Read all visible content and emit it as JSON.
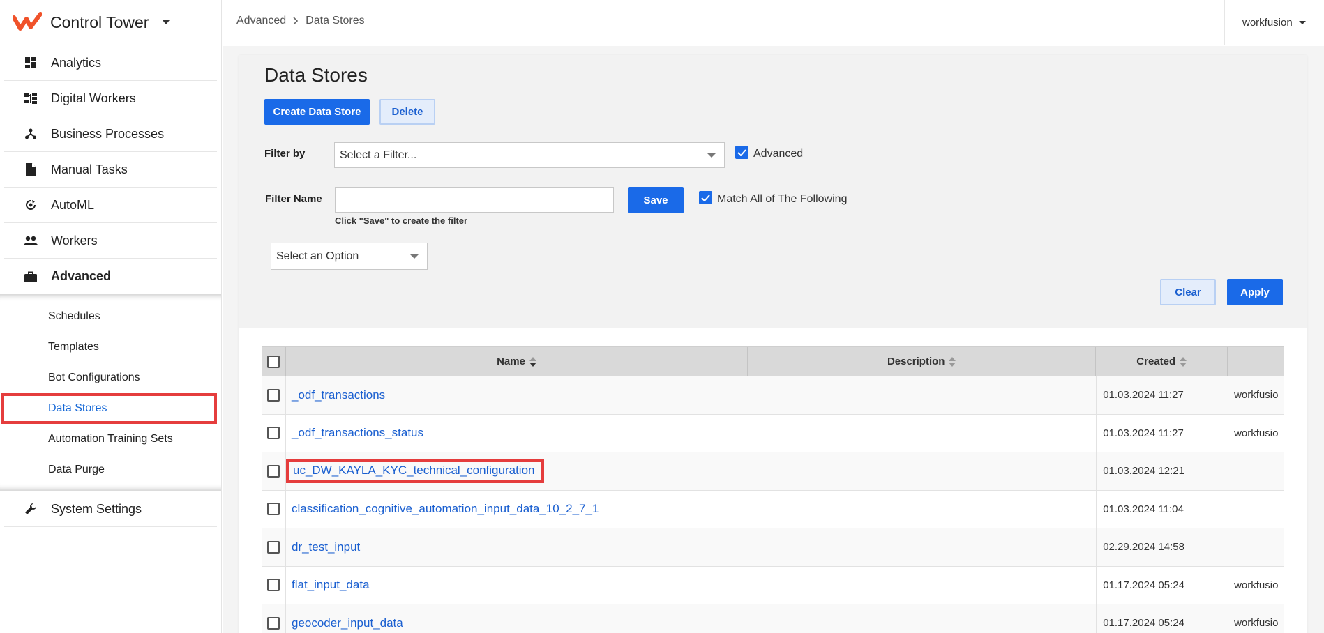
{
  "app": {
    "title": "Control Tower"
  },
  "sidebar": {
    "items": [
      {
        "label": "Analytics",
        "icon": "dashboard-icon"
      },
      {
        "label": "Digital Workers",
        "icon": "sitemap-icon"
      },
      {
        "label": "Business Processes",
        "icon": "process-icon"
      },
      {
        "label": "Manual Tasks",
        "icon": "document-icon"
      },
      {
        "label": "AutoML",
        "icon": "automl-icon"
      },
      {
        "label": "Workers",
        "icon": "people-icon"
      },
      {
        "label": "Advanced",
        "icon": "briefcase-icon"
      }
    ],
    "advanced_sub": [
      {
        "label": "Schedules"
      },
      {
        "label": "Templates"
      },
      {
        "label": "Bot Configurations"
      },
      {
        "label": "Data Stores"
      },
      {
        "label": "Automation Training Sets"
      },
      {
        "label": "Data Purge"
      }
    ],
    "bottom_item": {
      "label": "System Settings",
      "icon": "wrench-icon"
    },
    "active_item": "Advanced",
    "selected_sub": "Data Stores"
  },
  "header": {
    "breadcrumb": [
      "Advanced",
      "Data Stores"
    ],
    "user": "workfusion"
  },
  "page": {
    "title": "Data Stores",
    "create_label": "Create Data Store",
    "delete_label": "Delete",
    "filter_by_label": "Filter by",
    "filter_select_placeholder": "Select a Filter...",
    "advanced_label": "Advanced",
    "advanced_checked": true,
    "filter_name_label": "Filter Name",
    "filter_name_value": "",
    "save_label": "Save",
    "save_hint": "Click \"Save\" to create the filter",
    "match_all_label": "Match All of The Following",
    "match_all_checked": true,
    "option_select_placeholder": "Select an Option",
    "clear_label": "Clear",
    "apply_label": "Apply"
  },
  "table": {
    "columns": [
      "Name",
      "Description",
      "Created"
    ],
    "rows": [
      {
        "name": "_odf_transactions",
        "description": "",
        "created": "01.03.2024 11:27",
        "owner": "workfusio"
      },
      {
        "name": "_odf_transactions_status",
        "description": "",
        "created": "01.03.2024 11:27",
        "owner": "workfusio"
      },
      {
        "name": "uc_DW_KAYLA_KYC_technical_configuration",
        "description": "",
        "created": "01.03.2024 12:21",
        "owner": ""
      },
      {
        "name": "classification_cognitive_automation_input_data_10_2_7_1",
        "description": "",
        "created": "01.03.2024 11:04",
        "owner": ""
      },
      {
        "name": "dr_test_input",
        "description": "",
        "created": "02.29.2024 14:58",
        "owner": ""
      },
      {
        "name": "flat_input_data",
        "description": "",
        "created": "01.17.2024 05:24",
        "owner": "workfusio"
      },
      {
        "name": "geocoder_input_data",
        "description": "",
        "created": "01.17.2024 05:24",
        "owner": "workfusio"
      }
    ],
    "highlighted_row": "uc_DW_KAYLA_KYC_technical_configuration"
  },
  "colors": {
    "accent": "#1a6ae8",
    "link": "#1a5fd0",
    "highlight": "#e53d3d",
    "logo": "#f0522a"
  }
}
